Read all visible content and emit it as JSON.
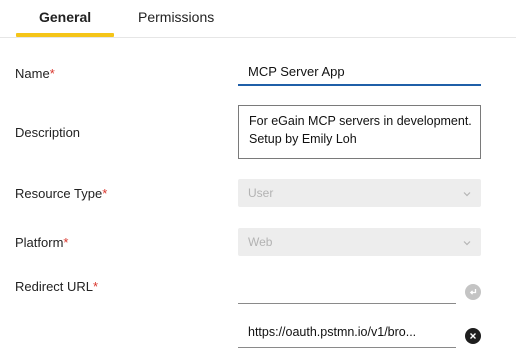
{
  "tabs": {
    "general": "General",
    "permissions": "Permissions"
  },
  "form": {
    "name": {
      "label": "Name",
      "required": "*",
      "value": "MCP Server App"
    },
    "description": {
      "label": "Description",
      "value": "For eGain MCP servers in development. Setup by Emily Loh"
    },
    "resource_type": {
      "label": "Resource Type",
      "required": "*",
      "value": "User"
    },
    "platform": {
      "label": "Platform",
      "required": "*",
      "value": "Web"
    },
    "redirect_url": {
      "label": "Redirect URL",
      "required": "*",
      "new_value": "",
      "existing_value": "https://oauth.pstmn.io/v1/bro..."
    }
  },
  "colors": {
    "accent_tab": "#f5c518",
    "focus_underline": "#1f5fa8",
    "required": "#d9342b"
  },
  "icons": {
    "select_chevron": "chevron-down-icon",
    "add_url": "enter-arrow-icon",
    "remove_url": "close-icon"
  }
}
